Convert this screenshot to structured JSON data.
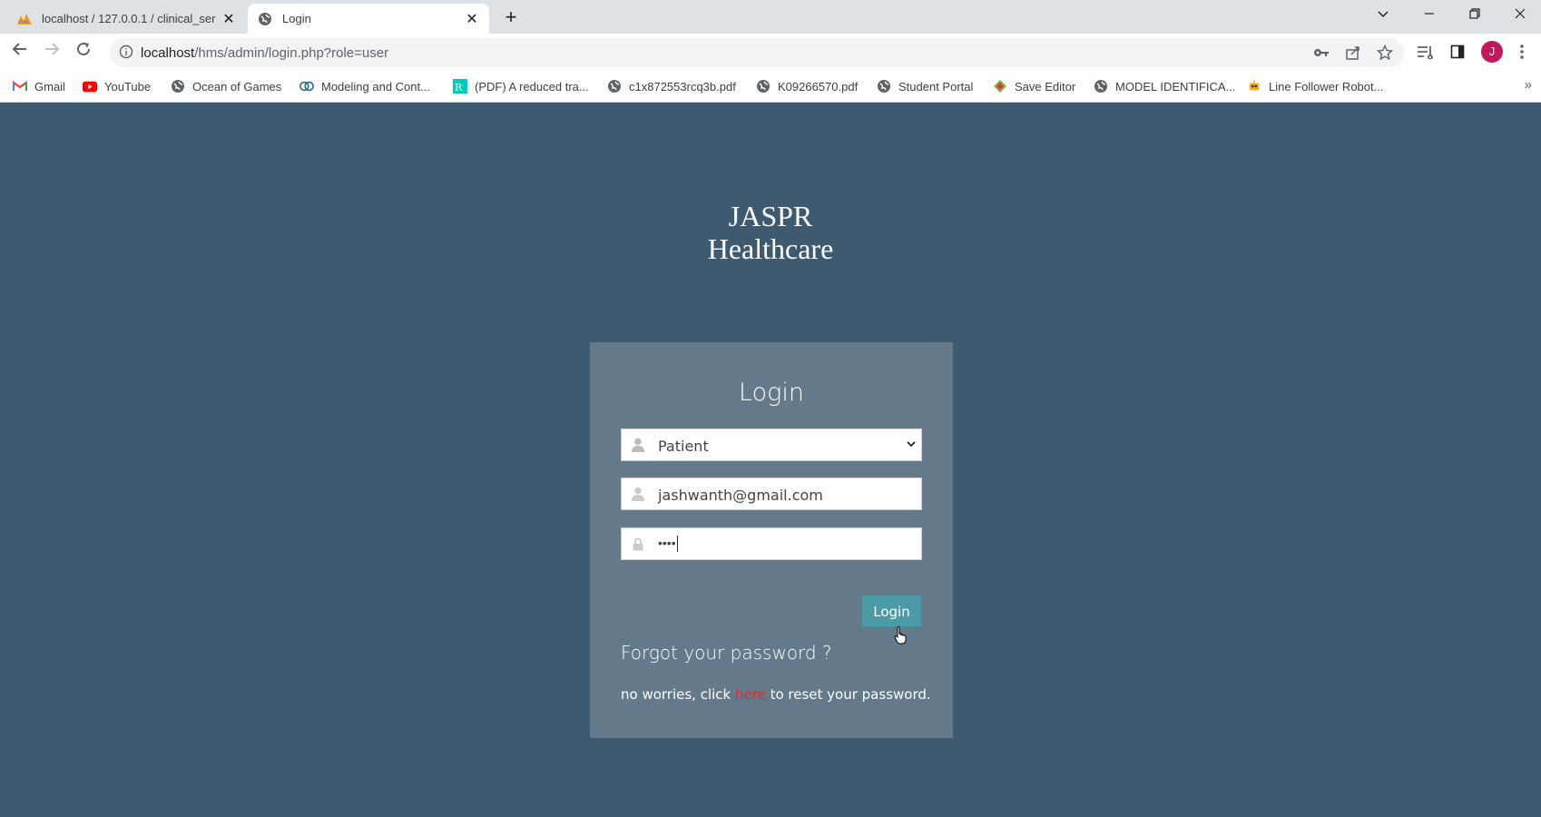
{
  "browser": {
    "tabs": [
      {
        "title": "localhost / 127.0.0.1 / clinical_ser",
        "favicon": "phpmyadmin-icon",
        "active": false
      },
      {
        "title": "Login",
        "favicon": "globe-icon",
        "active": true
      }
    ],
    "address": {
      "host": "localhost",
      "path": "/hms/admin/login.php?role=user"
    },
    "profile_initial": "J",
    "bookmarks": [
      {
        "label": "Gmail",
        "icon": "gmail-icon"
      },
      {
        "label": "YouTube",
        "icon": "youtube-icon"
      },
      {
        "label": "Ocean of Games",
        "icon": "globe-icon"
      },
      {
        "label": "Modeling and Cont...",
        "icon": "rings-icon"
      },
      {
        "label": "(PDF) A reduced tra...",
        "icon": "researchgate-icon"
      },
      {
        "label": "c1x872553rcq3b.pdf",
        "icon": "globe-icon"
      },
      {
        "label": "K09266570.pdf",
        "icon": "globe-icon"
      },
      {
        "label": "Student Portal",
        "icon": "globe-icon"
      },
      {
        "label": "Save Editor",
        "icon": "save-editor-icon"
      },
      {
        "label": "MODEL IDENTIFICA...",
        "icon": "globe-icon"
      },
      {
        "label": "Line Follower Robot...",
        "icon": "robot-icon"
      }
    ],
    "more_label": "»"
  },
  "page": {
    "brand_line1": "JASPR",
    "brand_line2": "Healthcare",
    "card_title": "Login",
    "role_select": {
      "value": "Patient"
    },
    "email": {
      "value": "jashwanth@gmail.com"
    },
    "password": {
      "masked": "••••"
    },
    "login_button": "Login",
    "forgot_heading": "Forgot your password ?",
    "reset_prefix": "no worries, click ",
    "reset_link": "here",
    "reset_suffix": " to reset your password."
  },
  "colors": {
    "page_background": "#3e5a70",
    "card_background": "#647a8a",
    "button": "#4b9aa7",
    "link": "#e8262b"
  }
}
